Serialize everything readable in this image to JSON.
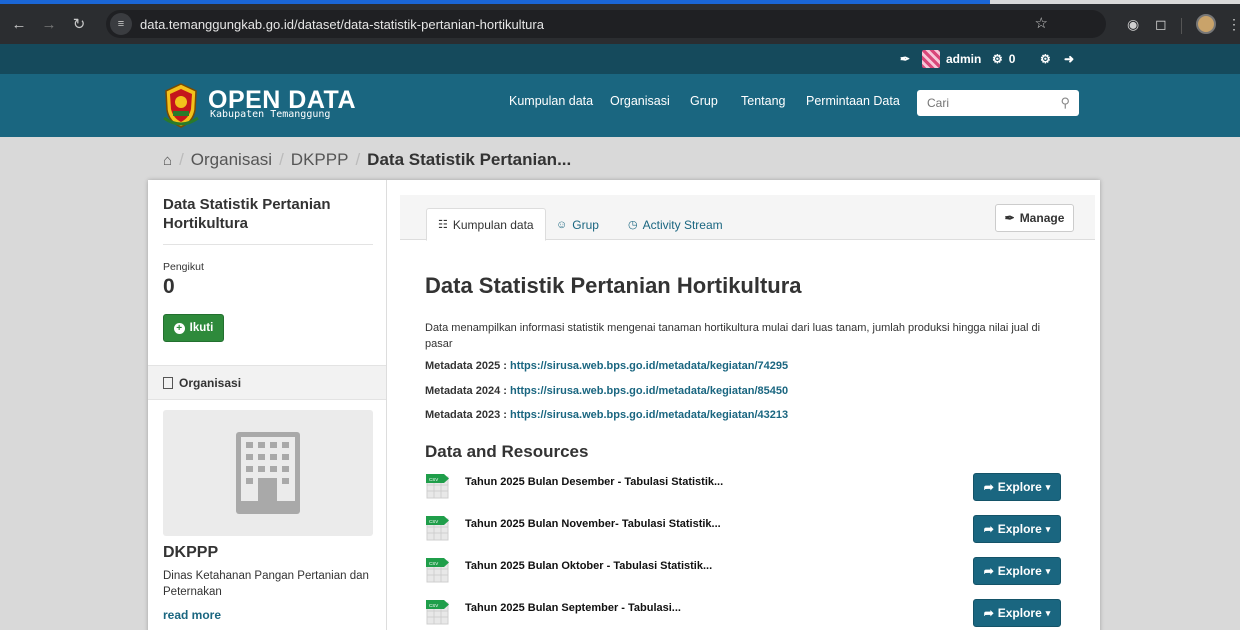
{
  "browser": {
    "url": "data.temanggungkab.go.id/dataset/data-statistik-pertanian-hortikultura"
  },
  "account": {
    "username": "admin",
    "dashboard_count": "0"
  },
  "site": {
    "title": "OPEN DATA",
    "subtitle": "Kabupaten Temanggung",
    "nav": [
      "Kumpulan data",
      "Organisasi",
      "Grup",
      "Tentang",
      "Permintaan Data"
    ],
    "search_placeholder": "Cari"
  },
  "breadcrumb": {
    "items": [
      "Organisasi",
      "DKPPP"
    ],
    "current": "Data Statistik Pertanian..."
  },
  "sidebar": {
    "title": "Data Statistik Pertanian Hortikultura",
    "followers_label": "Pengikut",
    "followers_count": "0",
    "follow_label": "Ikuti",
    "org_section_label": "Organisasi",
    "org_name": "DKPPP",
    "org_desc": "Dinas Ketahanan Pangan Pertanian dan Peternakan",
    "read_more": "read more"
  },
  "tabs": [
    {
      "label": "Kumpulan data",
      "icon": "sitemap-icon"
    },
    {
      "label": "Grup",
      "icon": "users-icon"
    },
    {
      "label": "Activity Stream",
      "icon": "clock-icon"
    }
  ],
  "manage_label": "Manage",
  "dataset": {
    "title": "Data Statistik Pertanian Hortikultura",
    "notes": "Data menampilkan informasi statistik mengenai tanaman hortikultura mulai dari luas tanam, jumlah produksi hingga nilai jual di pasar",
    "metadata": [
      {
        "label": "Metadata 2025 : ",
        "url": "https://sirusa.web.bps.go.id/metadata/kegiatan/74295"
      },
      {
        "label": "Metadata 2024 : ",
        "url": "https://sirusa.web.bps.go.id/metadata/kegiatan/85450"
      },
      {
        "label": "Metadata 2023 : ",
        "url": "https://sirusa.web.bps.go.id/metadata/kegiatan/43213"
      }
    ]
  },
  "resources": {
    "heading": "Data and Resources",
    "explore_label": "Explore",
    "items": [
      "Tahun 2025 Bulan Desember - Tabulasi Statistik...",
      "Tahun 2025 Bulan November- Tabulasi Statistik...",
      "Tahun 2025 Bulan Oktober - Tabulasi Statistik...",
      "Tahun 2025 Bulan September - Tabulasi..."
    ]
  },
  "colors": {
    "brand": "#1a6680",
    "account_bar": "#154a5c",
    "follow_green": "#2e8a3b"
  }
}
